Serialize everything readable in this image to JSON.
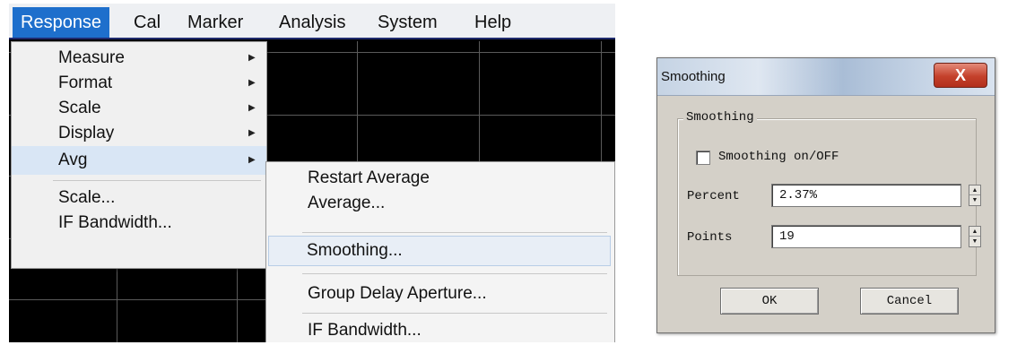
{
  "menubar": {
    "items": [
      "Response",
      "Cal",
      "Marker",
      "Analysis",
      "System",
      "Help"
    ],
    "active": "Response"
  },
  "response_menu": {
    "items": [
      {
        "label": "Measure",
        "submenu": true
      },
      {
        "label": "Format",
        "submenu": true
      },
      {
        "label": "Scale",
        "submenu": true
      },
      {
        "label": "Display",
        "submenu": true
      },
      {
        "label": "Avg",
        "submenu": true,
        "highlighted": true
      },
      {
        "label": "Scale...",
        "submenu": false
      },
      {
        "label": "IF Bandwidth...",
        "submenu": false
      }
    ]
  },
  "avg_submenu": {
    "items": [
      {
        "label": "Restart Average"
      },
      {
        "label": "Average..."
      },
      {
        "label": "Smoothing...",
        "selected": true
      },
      {
        "label": "Group Delay Aperture..."
      },
      {
        "label": "IF Bandwidth..."
      }
    ]
  },
  "dialog": {
    "title": "Smoothing",
    "close_label": "X",
    "group_title": "Smoothing",
    "checkbox_label": "Smoothing on/OFF",
    "checkbox_checked": false,
    "percent_label": "Percent",
    "percent_value": "2.37%",
    "points_label": "Points",
    "points_value": "19",
    "ok_label": "OK",
    "cancel_label": "Cancel"
  },
  "icons": {
    "submenu_arrow": "triangle-right-icon",
    "spin_up": "triangle-up-icon",
    "spin_down": "triangle-down-icon"
  },
  "colors": {
    "menu_highlight": "#1e6fcc",
    "close_button": "#c4412b",
    "dialog_face": "#d4d0c8"
  }
}
